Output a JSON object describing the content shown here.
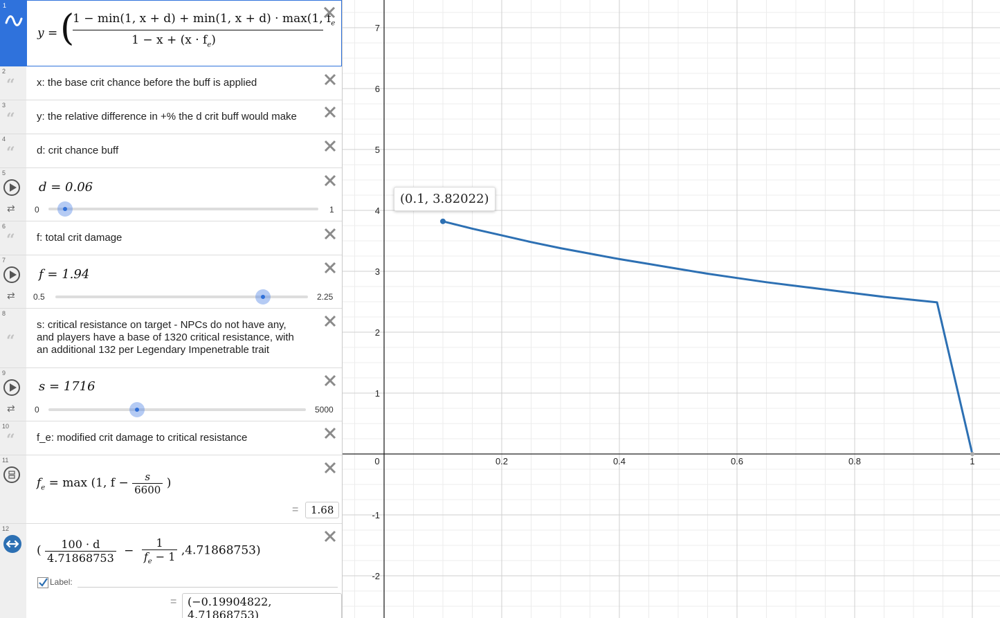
{
  "expressions": {
    "e1": {
      "index": "1",
      "lhs": "y =",
      "numerator": "1 − min(1, x + d) + min(1, x + d) · max(1, f",
      "numerator_sub": "e",
      "denominator": "1 − x + (x · f",
      "denominator_sub": "e",
      "denominator_end": ")"
    },
    "e2": {
      "index": "2",
      "text": "x: the base crit chance before the buff is applied"
    },
    "e3": {
      "index": "3",
      "text": "y: the relative difference in +% the d crit buff would make"
    },
    "e4": {
      "index": "4",
      "text": "d: crit chance buff"
    },
    "e5": {
      "index": "5",
      "equation": "d = 0.06",
      "slider_min": "0",
      "slider_max": "1",
      "slider_value": 0.06
    },
    "e6": {
      "index": "6",
      "text": "f: total crit damage"
    },
    "e7": {
      "index": "7",
      "equation": "f = 1.94",
      "slider_min": "0.5",
      "slider_max": "2.25",
      "slider_value": 1.94
    },
    "e8": {
      "index": "8",
      "line1": "s: critical resistance on target - NPCs do not have any,",
      "line2": "and players have a base of 1320 critical resistance, with",
      "line3": "an additional 132 per Legendary Impenetrable trait"
    },
    "e9": {
      "index": "9",
      "equation": "s = 1716",
      "slider_min": "0",
      "slider_max": "5000",
      "slider_value": 1716
    },
    "e10": {
      "index": "10",
      "text": "f_e: modified crit damage to critical resistance"
    },
    "e11": {
      "index": "11",
      "lhs": "f",
      "lhs_sub": "e",
      "rhs_start": "= max (1, f −",
      "frac_num": "s",
      "frac_den": "6600",
      "rhs_end": ")",
      "result_eq": "=",
      "result": "1.68"
    },
    "e12": {
      "index": "12",
      "open": "(",
      "frac1_num": "100 · d",
      "frac1_den": "4.71868753",
      "minus": "−",
      "frac2_num": "1",
      "frac2_den": "f",
      "frac2_den_sub": "e",
      "frac2_den_end": " − 1",
      "tail": ",4.71868753)",
      "label_text": "Label:",
      "result_eq": "=",
      "result": "(−0.19904822, 4.71868753)"
    }
  },
  "tooltip": "(0.1, 3.82022)",
  "chart_data": {
    "type": "line",
    "title": "",
    "xlabel": "",
    "ylabel": "",
    "xlim": [
      -0.07,
      1.03
    ],
    "ylim": [
      -2.6,
      7.4
    ],
    "x_ticks": [
      0,
      0.2,
      0.4,
      0.6,
      0.8,
      1
    ],
    "x_tick_labels": [
      "0",
      "0.2",
      "0.4",
      "0.6",
      "0.8",
      "1"
    ],
    "y_ticks": [
      -2,
      -1,
      1,
      2,
      3,
      4,
      5,
      6,
      7
    ],
    "y_tick_labels": [
      "-2",
      "-1",
      "1",
      "2",
      "3",
      "4",
      "5",
      "6",
      "7"
    ],
    "grid": true,
    "series": [
      {
        "color": "#2d70b3",
        "x": [
          0.1,
          0.15,
          0.2,
          0.25,
          0.3,
          0.35,
          0.4,
          0.45,
          0.5,
          0.55,
          0.6,
          0.65,
          0.7,
          0.75,
          0.8,
          0.85,
          0.9,
          0.94,
          1.0
        ],
        "y": [
          3.82,
          3.7,
          3.59,
          3.48,
          3.38,
          3.29,
          3.2,
          3.12,
          3.04,
          2.96,
          2.89,
          2.82,
          2.76,
          2.7,
          2.64,
          2.58,
          2.53,
          2.49,
          0
        ]
      }
    ],
    "marked_point": {
      "x": 0.1,
      "y": 3.82022
    }
  }
}
